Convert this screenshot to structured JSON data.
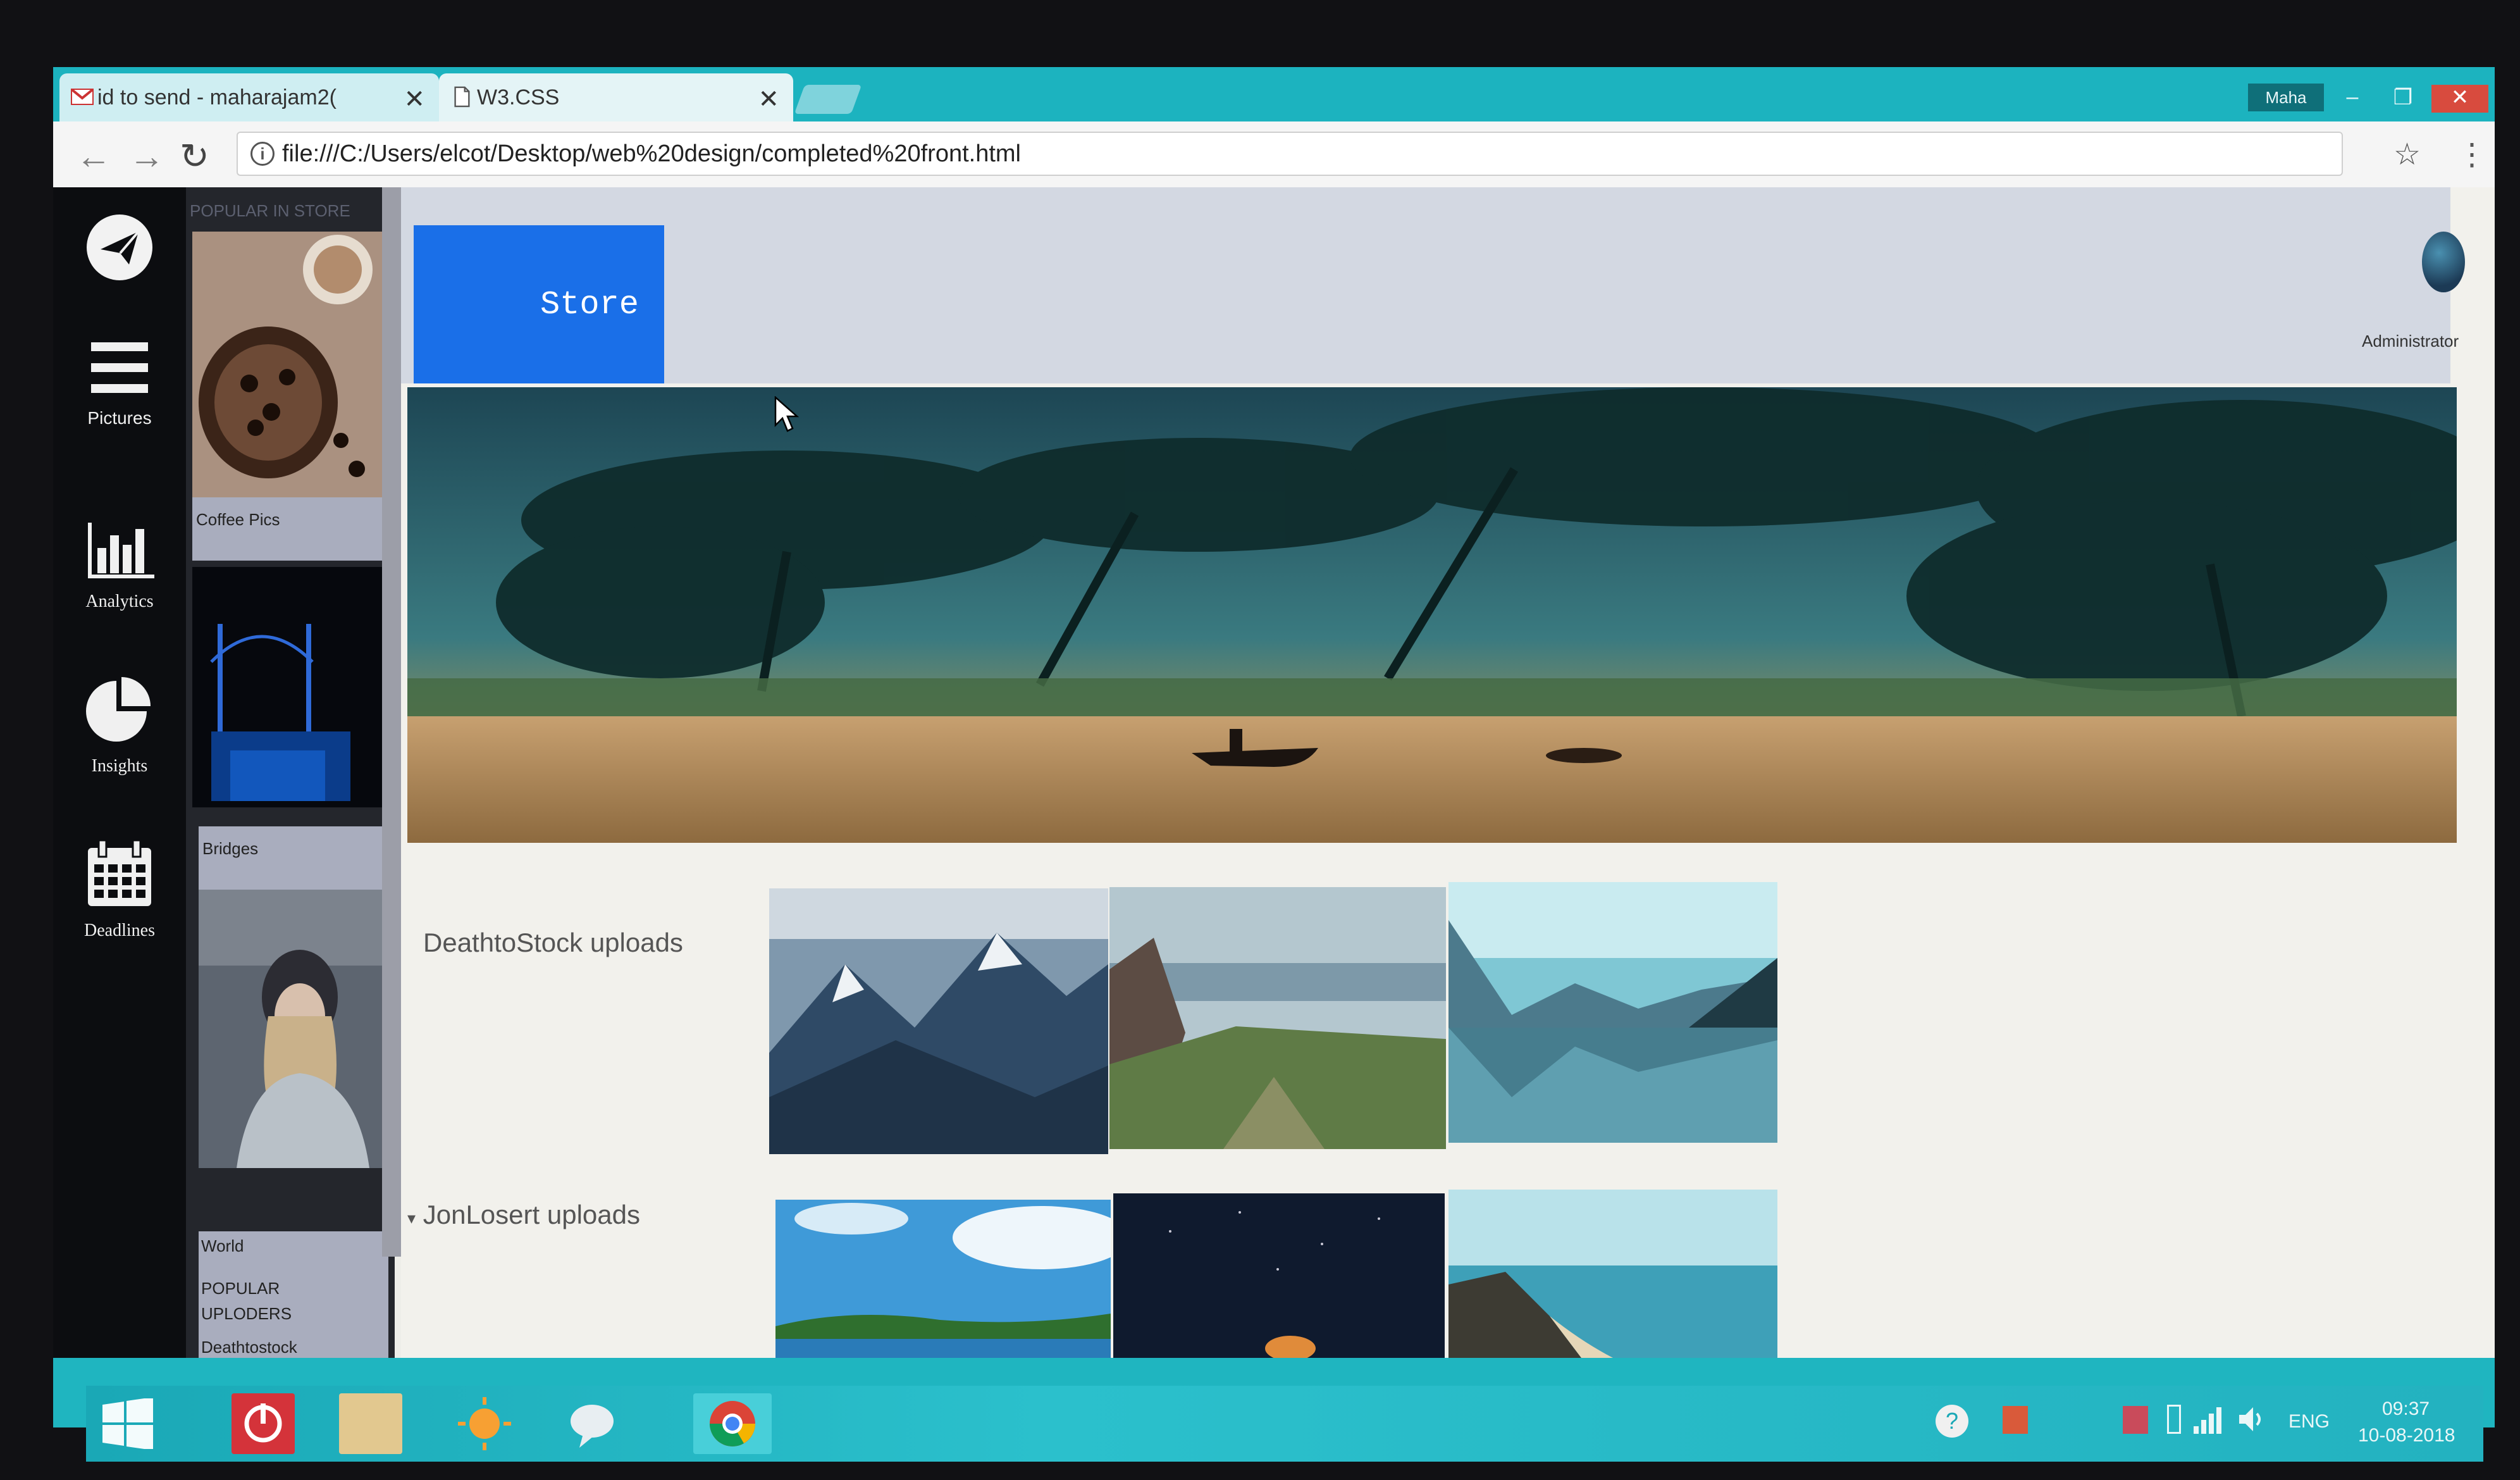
{
  "browser": {
    "tabs": [
      {
        "label": "id to send - maharajam2(",
        "icon": "gmail-icon"
      },
      {
        "label": "W3.CSS",
        "icon": "document-icon"
      }
    ],
    "user_badge": "Maha",
    "url": "file:///C:/Users/elcot/Desktop/web%20design/completed%20front.html",
    "close_glyph": "✕",
    "minimize_glyph": "–",
    "restore_glyph": "❐"
  },
  "sidebar": {
    "items": [
      {
        "label": "",
        "icon": "paper-plane-icon"
      },
      {
        "label": "Pictures",
        "icon": "hamburger-menu-icon"
      },
      {
        "label": "Analytics",
        "icon": "bar-chart-icon"
      },
      {
        "label": "Insights",
        "icon": "pie-chart-icon"
      },
      {
        "label": "Deadlines",
        "icon": "calendar-icon"
      }
    ]
  },
  "popular": {
    "heading": "POPULAR IN STORE",
    "items": [
      {
        "label": "Coffee Pics"
      },
      {
        "label": "Bridges"
      },
      {
        "label": "World"
      }
    ],
    "uploaders_heading": "POPULAR UPLODERS",
    "uploaders": [
      "Deathtostock"
    ]
  },
  "header": {
    "store_label": "Store",
    "admin_label": "Administrator"
  },
  "sections": [
    {
      "label": "DeathtoStock uploads",
      "thumbs": [
        "mountain-peaks",
        "valley-view",
        "lake-reflection"
      ]
    },
    {
      "label": "JonLosert uploads",
      "thumbs": [
        "sky-lake",
        "night-fire",
        "coastline"
      ]
    }
  ],
  "taskbar": {
    "language": "ENG",
    "time": "09:37",
    "date": "10-08-2018"
  },
  "colors": {
    "accent": "#1a6fe8",
    "chrome": "#1cb3bf",
    "sidebar": "#0c0d10",
    "close": "#d84b3e"
  }
}
